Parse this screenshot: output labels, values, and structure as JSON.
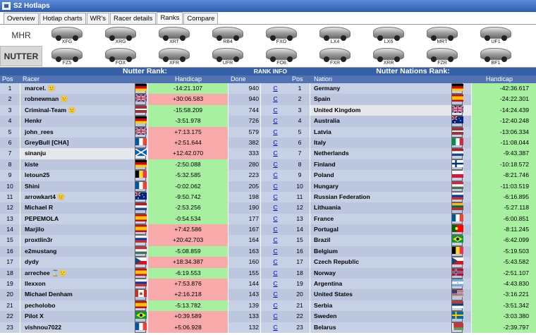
{
  "window": {
    "title": "S2 Hotlaps"
  },
  "tabs": [
    "Overview",
    "Hotlap charts",
    "WR's",
    "Racer details",
    "Ranks",
    "Compare"
  ],
  "active_tab": "Ranks",
  "modes": {
    "mhr": "MHR",
    "nutter": "NUTTER"
  },
  "cars_top": [
    "XFG",
    "XRG",
    "XRT",
    "RB4",
    "FXO",
    "LX4",
    "LX6",
    "MRT",
    "UF1"
  ],
  "cars_bottom": [
    "FZ5",
    "FOX",
    "XFR",
    "UFR",
    "FO8",
    "FXR",
    "XRR",
    "FZR",
    "BF1"
  ],
  "left": {
    "title": "Nutter Rank:",
    "rank_info": "RANK INFO",
    "headers": {
      "pos": "Pos",
      "racer": "Racer",
      "handicap": "Handicap",
      "done": "Done"
    },
    "link": "C",
    "rows": [
      {
        "pos": "1",
        "name": "marcel.",
        "h": "-14:21.107",
        "done": "940",
        "flag": "de",
        "badge": "🙂"
      },
      {
        "pos": "2",
        "name": "robnewman",
        "h": "+30:06.583",
        "done": "940",
        "flag": "gb",
        "badge": "🙂"
      },
      {
        "pos": "3",
        "name": "Criminal-Team",
        "h": "-15:58.209",
        "done": "744",
        "flag": "lv",
        "badge": "🙂"
      },
      {
        "pos": "4",
        "name": "Henkr",
        "h": "-3:51.978",
        "done": "726",
        "flag": "de",
        "badge": ""
      },
      {
        "pos": "5",
        "name": "john_rees",
        "h": "+7:13.175",
        "done": "579",
        "flag": "gb",
        "badge": ""
      },
      {
        "pos": "6",
        "name": "GreyBull [CHA]",
        "h": "+2:51.644",
        "done": "382",
        "flag": "fr",
        "badge": ""
      },
      {
        "pos": "7",
        "name": "sinanju",
        "h": "+12:42.070",
        "done": "333",
        "flag": "sc",
        "badge": ""
      },
      {
        "pos": "8",
        "name": "kiste",
        "h": "-2:50.088",
        "done": "280",
        "flag": "de",
        "badge": ""
      },
      {
        "pos": "9",
        "name": "letoun25",
        "h": "-5:32.585",
        "done": "223",
        "flag": "be",
        "badge": ""
      },
      {
        "pos": "10",
        "name": "Shini",
        "h": "-0:02.062",
        "done": "205",
        "flag": "fr",
        "badge": ""
      },
      {
        "pos": "11",
        "name": "arrowkart4",
        "h": "-9:50.742",
        "done": "198",
        "flag": "au",
        "badge": "🙂"
      },
      {
        "pos": "12",
        "name": "Michael R",
        "h": "-2:53.256",
        "done": "190",
        "flag": "nl",
        "badge": ""
      },
      {
        "pos": "13",
        "name": "PEPEMOLA",
        "h": "-0:54.534",
        "done": "177",
        "flag": "es",
        "badge": ""
      },
      {
        "pos": "14",
        "name": "Marjilo",
        "h": "+7:42.586",
        "done": "167",
        "flag": "es",
        "badge": ""
      },
      {
        "pos": "15",
        "name": "proxtlin3r",
        "h": "+20:42.703",
        "done": "164",
        "flag": "ru",
        "badge": ""
      },
      {
        "pos": "16",
        "name": "e2mustang",
        "h": "-5:08.859",
        "done": "163",
        "flag": "hu",
        "badge": ""
      },
      {
        "pos": "17",
        "name": "dydy",
        "h": "+18:34.387",
        "done": "160",
        "flag": "cz",
        "badge": ""
      },
      {
        "pos": "18",
        "name": "arrechee",
        "h": "-6:19.553",
        "done": "155",
        "flag": "es",
        "badge": "⌛🙂"
      },
      {
        "pos": "19",
        "name": "llexxon",
        "h": "+7:53.876",
        "done": "144",
        "flag": "ru",
        "badge": ""
      },
      {
        "pos": "20",
        "name": "Michael Denham",
        "h": "+2:16.218",
        "done": "143",
        "flag": "ca",
        "badge": ""
      },
      {
        "pos": "21",
        "name": "pecholobo",
        "h": "-5:13.782",
        "done": "139",
        "flag": "es",
        "badge": ""
      },
      {
        "pos": "22",
        "name": "Pilot X",
        "h": "+0:39.589",
        "done": "133",
        "flag": "br",
        "badge": ""
      },
      {
        "pos": "23",
        "name": "vishnou7022",
        "h": "+5:06.928",
        "done": "132",
        "flag": "fr",
        "badge": ""
      }
    ]
  },
  "right": {
    "title": "Nutter Nations Rank:",
    "headers": {
      "pos": "Pos",
      "nation": "Nation",
      "handicap": "Handicap"
    },
    "rows": [
      {
        "pos": "1",
        "name": "Germany",
        "h": "-42:36.617",
        "flag": "de"
      },
      {
        "pos": "2",
        "name": "Spain",
        "h": "-24:22.301",
        "flag": "es"
      },
      {
        "pos": "3",
        "name": "United Kingdom",
        "h": "-14:24.439",
        "flag": "gb"
      },
      {
        "pos": "4",
        "name": "Australia",
        "h": "-12:40.248",
        "flag": "au"
      },
      {
        "pos": "5",
        "name": "Latvia",
        "h": "-13:06.334",
        "flag": "lv"
      },
      {
        "pos": "6",
        "name": "Italy",
        "h": "-11:08.044",
        "flag": "it"
      },
      {
        "pos": "7",
        "name": "Netherlands",
        "h": "-9:43.387",
        "flag": "nl"
      },
      {
        "pos": "8",
        "name": "Finland",
        "h": "-10:18.572",
        "flag": "fi"
      },
      {
        "pos": "9",
        "name": "Poland",
        "h": "-8:21.746",
        "flag": "pl"
      },
      {
        "pos": "10",
        "name": "Hungary",
        "h": "-11:03.519",
        "flag": "hu"
      },
      {
        "pos": "11",
        "name": "Russian Federation",
        "h": "-6:16.895",
        "flag": "ru"
      },
      {
        "pos": "12",
        "name": "Lithuania",
        "h": "-5:27.118",
        "flag": "lt"
      },
      {
        "pos": "13",
        "name": "France",
        "h": "-6:00.851",
        "flag": "fr"
      },
      {
        "pos": "14",
        "name": "Portugal",
        "h": "-8:11.245",
        "flag": "pt"
      },
      {
        "pos": "15",
        "name": "Brazil",
        "h": "-6:42.099",
        "flag": "br"
      },
      {
        "pos": "16",
        "name": "Belgium",
        "h": "-5:19.503",
        "flag": "be"
      },
      {
        "pos": "17",
        "name": "Czech Republic",
        "h": "-5:43.582",
        "flag": "cz"
      },
      {
        "pos": "18",
        "name": "Norway",
        "h": "-2:51.107",
        "flag": "no"
      },
      {
        "pos": "19",
        "name": "Argentina",
        "h": "-4:43.830",
        "flag": "ar"
      },
      {
        "pos": "20",
        "name": "United States",
        "h": "-3:16.221",
        "flag": "us"
      },
      {
        "pos": "21",
        "name": "Serbia",
        "h": "-3:51.342",
        "flag": "rs"
      },
      {
        "pos": "22",
        "name": "Sweden",
        "h": "-3:03.380",
        "flag": "se"
      },
      {
        "pos": "23",
        "name": "Belarus",
        "h": "-2:39.797",
        "flag": "by"
      }
    ]
  },
  "colors": {
    "negative": "#a6f0a0",
    "positive": "#f8a9a9",
    "header": "#3560a8",
    "subheader": "#5173b4",
    "cell": "#c7d1e6"
  }
}
